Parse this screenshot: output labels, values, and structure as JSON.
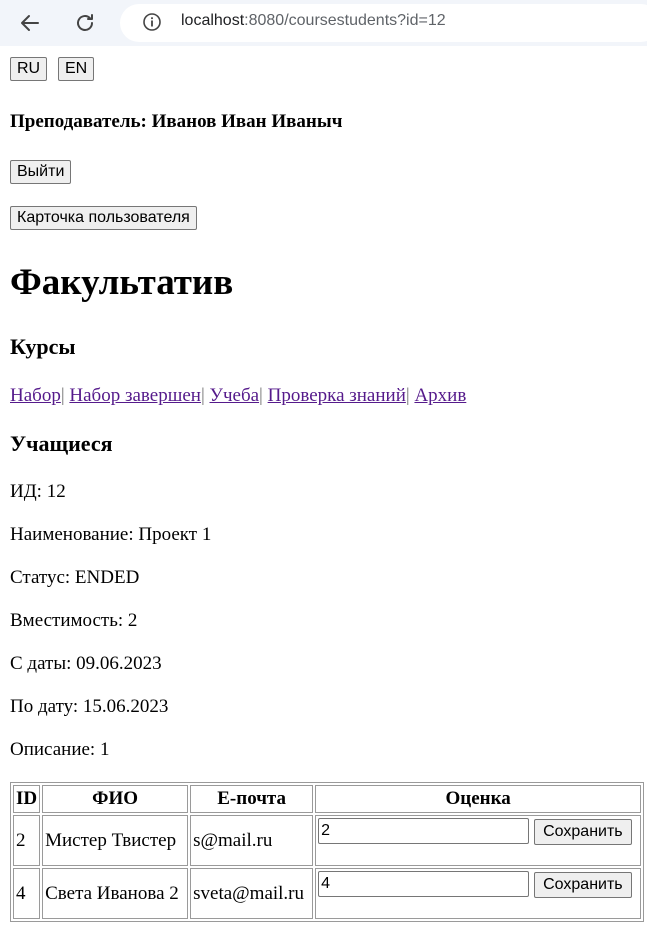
{
  "browser": {
    "url_host": "localhost",
    "url_rest": ":8080/coursestudents?id=12"
  },
  "lang": {
    "ru": "RU",
    "en": "EN"
  },
  "teacher_line": "Преподаватель: Иванов Иван Иваныч",
  "logout_label": "Выйти",
  "profile_label": "Карточка пользователя",
  "title": "Факультатив",
  "courses_heading": "Курсы",
  "course_links": [
    "Набор",
    "Набор завершен",
    "Учеба",
    "Проверка знаний",
    "Архив"
  ],
  "students_heading": "Учащиеся",
  "info": {
    "id": "ИД: 12",
    "name": "Наименование: Проект 1",
    "status": "Статус: ENDED",
    "capacity": "Вместимость: 2",
    "from": "С даты: 09.06.2023",
    "to": "По дату: 15.06.2023",
    "description": "Описание: 1"
  },
  "table": {
    "headers": [
      "ID",
      "ФИО",
      "Е-почта",
      "Оценка"
    ],
    "rows": [
      {
        "id": "2",
        "name": "Мистер Твистер",
        "email": "s@mail.ru",
        "grade": "2",
        "save": "Сохранить"
      },
      {
        "id": "4",
        "name": "Света Иванова 2",
        "email": "sveta@mail.ru",
        "grade": "4",
        "save": "Сохранить"
      }
    ]
  }
}
